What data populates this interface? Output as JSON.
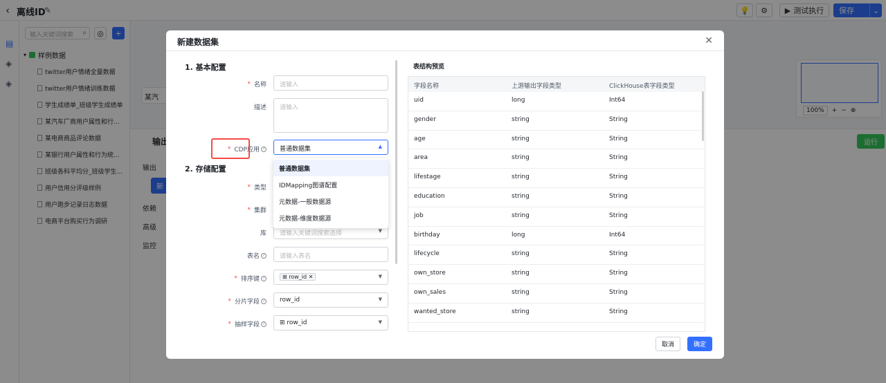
{
  "topbar": {
    "title": "离线ID",
    "test_run": "测试执行",
    "save": "保存"
  },
  "tree": {
    "search_placeholder": "输入关键词搜索",
    "root": "样例数据",
    "items": [
      "twitter用户情绪全量数据",
      "twitter用户情绪训练数据",
      "学生成绩单_班级学生成绩单",
      "某汽车厂商用户属性和行...",
      "某电商商品评论数据",
      "某银行用户属性和行为统...",
      "班级各科平均分_班级学生...",
      "用户信用分评级样例",
      "用户跑步记录日志数据",
      "电商平台购买行为调研"
    ]
  },
  "canvas": {
    "node_label": "某汽",
    "zoom": "100%"
  },
  "bottom": {
    "output": "输出",
    "output2": "输出",
    "new": "新",
    "dep": "依赖",
    "adv": "高级",
    "mon": "监控",
    "run": "运行"
  },
  "modal": {
    "title": "新建数据集",
    "sec1": "1. 基本配置",
    "sec2": "2. 存储配置",
    "name_label": "名称",
    "name_ph": "请输入",
    "desc_label": "描述",
    "desc_ph": "请输入",
    "cdp_label": "CDP应用",
    "cdp_value": "普通数据集",
    "type_label": "类型",
    "cluster_label": "集群",
    "db_label": "库",
    "db_ph": "请输入关键词搜索选择",
    "table_label": "表名",
    "table_ph": "请输入表名",
    "sort_label": "排序键",
    "sort_tag": "row_id",
    "shard_label": "分片字段",
    "shard_value": "row_id",
    "sample_label": "抽样字段",
    "sample_value": "row_id",
    "options": [
      "普通数据集",
      "IDMapping图谱配置",
      "元数据-一般数据源",
      "元数据-维度数据源"
    ],
    "preview_title": "表结构预览",
    "columns": [
      "字段名称",
      "上游输出字段类型",
      "ClickHouse表字段类型"
    ],
    "rows": [
      [
        "uid",
        "long",
        "Int64"
      ],
      [
        "gender",
        "string",
        "String"
      ],
      [
        "age",
        "string",
        "String"
      ],
      [
        "area",
        "string",
        "String"
      ],
      [
        "lifestage",
        "string",
        "String"
      ],
      [
        "education",
        "string",
        "String"
      ],
      [
        "job",
        "string",
        "String"
      ],
      [
        "birthday",
        "long",
        "Int64"
      ],
      [
        "lifecycle",
        "string",
        "String"
      ],
      [
        "own_store",
        "string",
        "String"
      ],
      [
        "own_sales",
        "string",
        "String"
      ],
      [
        "wanted_store",
        "string",
        "String"
      ]
    ],
    "cancel": "取消",
    "ok": "确定"
  }
}
